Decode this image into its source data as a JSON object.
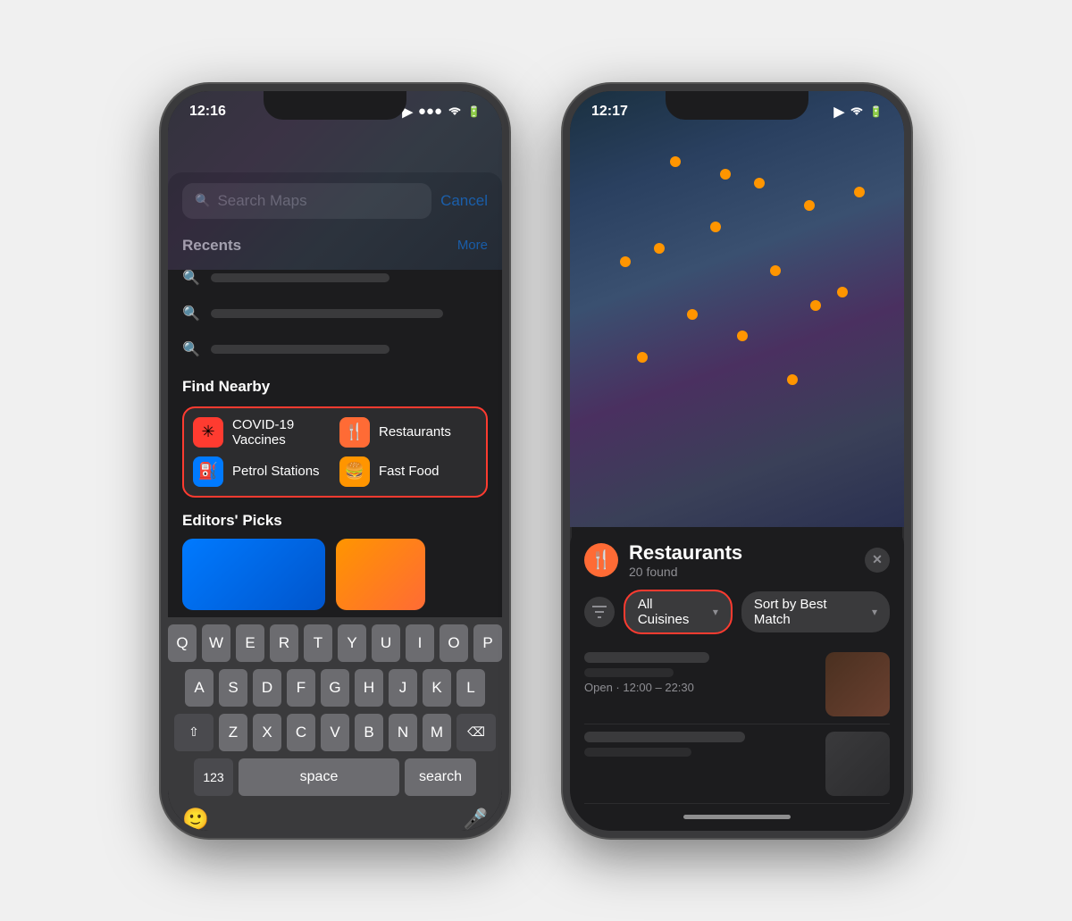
{
  "phone1": {
    "status_bar": {
      "time": "12:16",
      "time_icon": "▶",
      "wifi": "wifi-icon",
      "battery": "battery-icon"
    },
    "search": {
      "placeholder": "Search Maps",
      "cancel_label": "Cancel"
    },
    "recents": {
      "title": "Recents",
      "more_label": "More"
    },
    "find_nearby": {
      "title": "Find Nearby",
      "items": [
        {
          "id": "covid",
          "label": "COVID-19 Vaccines",
          "icon": "✳",
          "color": "#ff3b30"
        },
        {
          "id": "restaurants",
          "label": "Restaurants",
          "icon": "🍴",
          "color": "#ff6b35"
        },
        {
          "id": "petrol",
          "label": "Petrol Stations",
          "icon": "⛽",
          "color": "#007aff"
        },
        {
          "id": "fastfood",
          "label": "Fast Food",
          "icon": "🍔",
          "color": "#ff9500"
        }
      ]
    },
    "editors_picks": {
      "title": "Editors' Picks"
    },
    "keyboard": {
      "rows": [
        [
          "Q",
          "W",
          "E",
          "R",
          "T",
          "Y",
          "U",
          "I",
          "O",
          "P"
        ],
        [
          "A",
          "S",
          "D",
          "F",
          "G",
          "H",
          "J",
          "K",
          "L"
        ],
        [
          "Z",
          "X",
          "C",
          "V",
          "B",
          "N",
          "M"
        ]
      ],
      "shift_label": "⇧",
      "backspace_label": "⌫",
      "nums_label": "123",
      "space_label": "space",
      "search_label": "search"
    }
  },
  "phone2": {
    "status_bar": {
      "time": "12:17"
    },
    "results": {
      "title": "Restaurants",
      "count": "20 found",
      "close_label": "✕",
      "restaurant_icon": "🍴",
      "filters": {
        "cuisine_label": "All Cuisines",
        "sort_label": "Sort by Best Match"
      },
      "open_hours": "Open · 12:00 – 22:30"
    }
  }
}
